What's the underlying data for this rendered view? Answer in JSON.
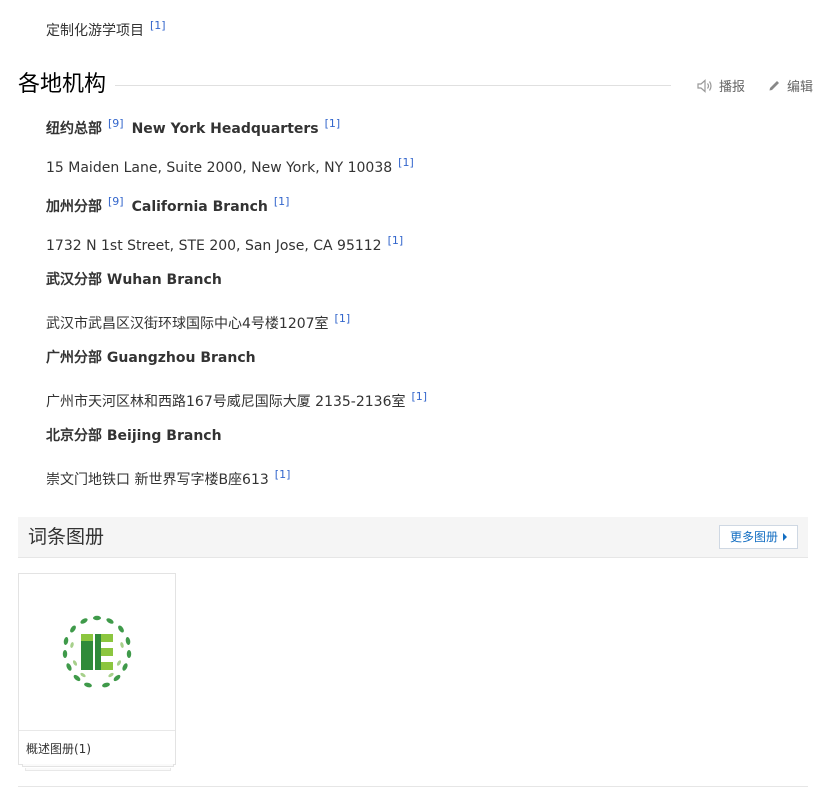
{
  "intro_item": {
    "text": "定制化游学项目",
    "ref": "[1]"
  },
  "section": {
    "title": "各地机构",
    "listen_label": "播报",
    "edit_label": "编辑"
  },
  "offices": [
    {
      "name_cn": "纽约总部",
      "name_ref": "[9]",
      "name_en": "New York Headquarters",
      "en_ref": "[1]",
      "address": "15 Maiden Lane, Suite 2000, New York, NY 10038",
      "addr_ref": "[1]"
    },
    {
      "name_cn": "加州分部",
      "name_ref": "[9]",
      "name_en": "California Branch",
      "en_ref": "[1]",
      "address": "1732 N 1st Street, STE 200, San Jose, CA 95112",
      "addr_ref": "[1]"
    },
    {
      "name": "武汉分部 Wuhan Branch",
      "address": "武汉市武昌区汉街环球国际中心4号楼1207室",
      "addr_ref": "[1]"
    },
    {
      "name": "广州分部 Guangzhou Branch",
      "address": "广州市天河区林和西路167号威尼国际大厦 2135-2136室",
      "addr_ref": "[1]"
    },
    {
      "name": "北京分部 Beijing Branch",
      "address": "崇文门地铁口 新世界写字楼B座613",
      "addr_ref": "[1]"
    }
  ],
  "album": {
    "title": "词条图册",
    "more_label": "更多图册",
    "card_caption": "概述图册(1)",
    "logo_icon": "laurel-logo-icon",
    "colors": {
      "laurel": "#3f9a4a",
      "block_dark": "#2f8a3a",
      "block_light": "#8cc63f",
      "link": "#3366cc"
    }
  }
}
